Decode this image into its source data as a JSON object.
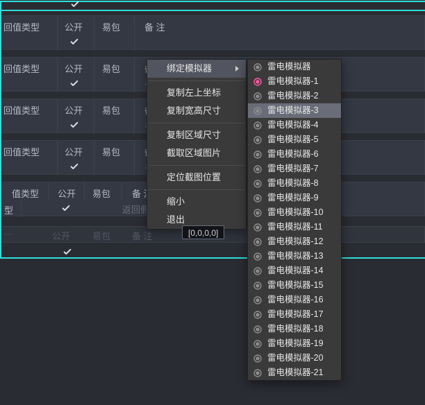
{
  "headers": {
    "return_type": "回值类型",
    "value_type": "值类型",
    "type": "型",
    "public": "公开",
    "easy_pkg": "易包",
    "remark": "备 注",
    "remark2": "备  注"
  },
  "hash_placeholder": "#",
  "hint_text": "返回假则取消阻止关闭",
  "tooltip_text": "[0,0,0,0]",
  "context_menu": {
    "bind_simulator": "绑定模拟器",
    "copy_top_left": "复制左上坐标",
    "copy_wh": "复制宽高尺寸",
    "copy_area": "复制区域尺寸",
    "capture_area": "截取区域图片",
    "locate_capture": "定位截图位置",
    "zoom_out": "缩小",
    "exit": "退出"
  },
  "simulators": {
    "base": "雷电模拟器",
    "items": [
      "雷电模拟器",
      "雷电模拟器-1",
      "雷电模拟器-2",
      "雷电模拟器-3",
      "雷电模拟器-4",
      "雷电模拟器-5",
      "雷电模拟器-6",
      "雷电模拟器-7",
      "雷电模拟器-8",
      "雷电模拟器-9",
      "雷电模拟器-10",
      "雷电模拟器-11",
      "雷电模拟器-12",
      "雷电模拟器-13",
      "雷电模拟器-14",
      "雷电模拟器-15",
      "雷电模拟器-16",
      "雷电模拟器-17",
      "雷电模拟器-18",
      "雷电模拟器-19",
      "雷电模拟器-20",
      "雷电模拟器-21"
    ],
    "selected_index": 1,
    "highlight_index": 3
  }
}
